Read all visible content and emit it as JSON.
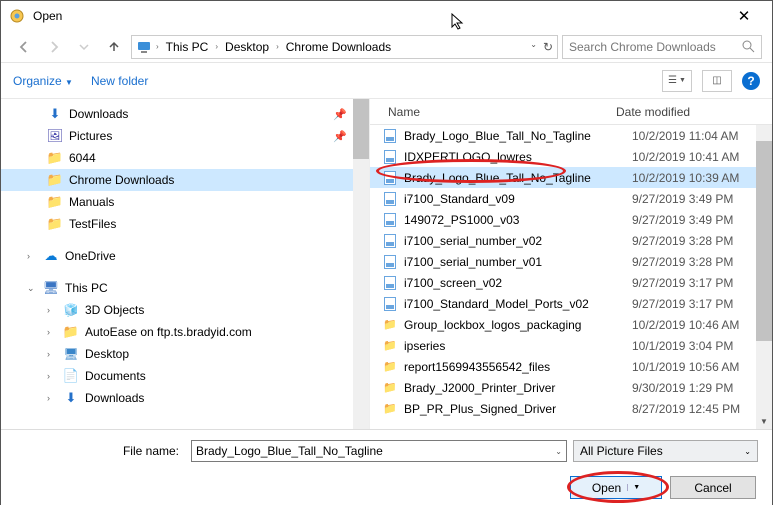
{
  "window": {
    "title": "Open"
  },
  "breadcrumb": {
    "root": "This PC",
    "p1": "Desktop",
    "p2": "Chrome Downloads"
  },
  "search": {
    "placeholder": "Search Chrome Downloads"
  },
  "toolbar": {
    "organize": "Organize",
    "newfolder": "New folder"
  },
  "tree": {
    "downloads": "Downloads",
    "pictures": "Pictures",
    "f6044": "6044",
    "chromedl": "Chrome Downloads",
    "manuals": "Manuals",
    "testfiles": "TestFiles",
    "onedrive": "OneDrive",
    "thispc": "This PC",
    "objects3d": "3D Objects",
    "autoease": "AutoEase on ftp.ts.bradyid.com",
    "desktop": "Desktop",
    "documents": "Documents",
    "downloads2": "Downloads"
  },
  "columns": {
    "name": "Name",
    "date": "Date modified"
  },
  "files": [
    {
      "name": "Brady_Logo_Blue_Tall_No_Tagline",
      "date": "10/2/2019 11:04 AM",
      "type": "file"
    },
    {
      "name": "IDXPERTLOGO_lowres",
      "date": "10/2/2019 10:41 AM",
      "type": "file"
    },
    {
      "name": "Brady_Logo_Blue_Tall_No_Tagline",
      "date": "10/2/2019 10:39 AM",
      "type": "file",
      "selected": true
    },
    {
      "name": "i7100_Standard_v09",
      "date": "9/27/2019 3:49 PM",
      "type": "file"
    },
    {
      "name": "149072_PS1000_v03",
      "date": "9/27/2019 3:49 PM",
      "type": "file"
    },
    {
      "name": "i7100_serial_number_v02",
      "date": "9/27/2019 3:28 PM",
      "type": "file"
    },
    {
      "name": "i7100_serial_number_v01",
      "date": "9/27/2019 3:28 PM",
      "type": "file"
    },
    {
      "name": "i7100_screen_v02",
      "date": "9/27/2019 3:17 PM",
      "type": "file"
    },
    {
      "name": "i7100_Standard_Model_Ports_v02",
      "date": "9/27/2019 3:17 PM",
      "type": "file"
    },
    {
      "name": "Group_lockbox_logos_packaging",
      "date": "10/2/2019 10:46 AM",
      "type": "folder"
    },
    {
      "name": "ipseries",
      "date": "10/1/2019 3:04 PM",
      "type": "folder"
    },
    {
      "name": "report1569943556542_files",
      "date": "10/1/2019 10:56 AM",
      "type": "folder"
    },
    {
      "name": "Brady_J2000_Printer_Driver",
      "date": "9/30/2019 1:29 PM",
      "type": "folder"
    },
    {
      "name": "BP_PR_Plus_Signed_Driver",
      "date": "8/27/2019 12:45 PM",
      "type": "folder"
    }
  ],
  "footer": {
    "filename_label": "File name:",
    "filename_value": "Brady_Logo_Blue_Tall_No_Tagline",
    "filter": "All Picture Files",
    "open": "Open",
    "cancel": "Cancel"
  }
}
